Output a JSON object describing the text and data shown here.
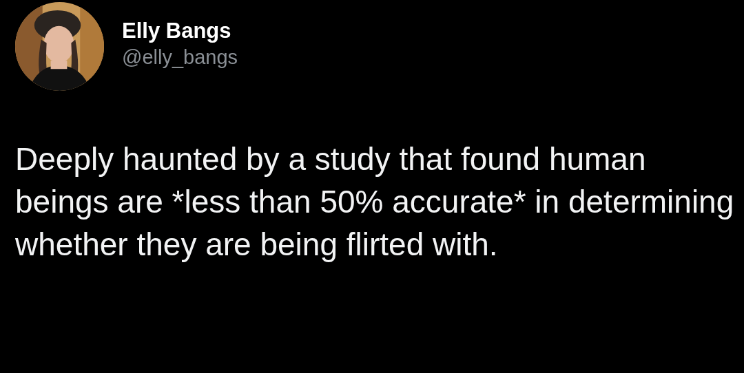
{
  "tweet": {
    "author": {
      "name": "Elly Bangs",
      "handle": "@elly_bangs"
    },
    "text": "Deeply haunted by a study that found human beings are *less than 50% accurate* in determining whether they are being flirted with."
  }
}
